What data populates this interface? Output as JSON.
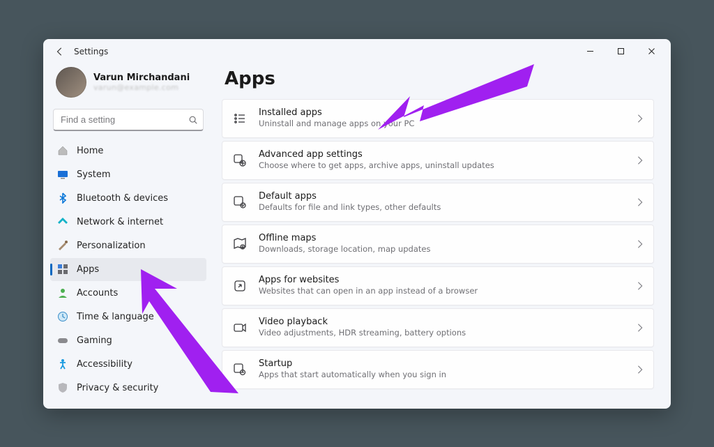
{
  "window": {
    "title": "Settings"
  },
  "profile": {
    "name": "Varun Mirchandani",
    "sub": "varun@example.com"
  },
  "search": {
    "placeholder": "Find a setting"
  },
  "sidebar": {
    "items": [
      {
        "label": "Home"
      },
      {
        "label": "System"
      },
      {
        "label": "Bluetooth & devices"
      },
      {
        "label": "Network & internet"
      },
      {
        "label": "Personalization"
      },
      {
        "label": "Apps"
      },
      {
        "label": "Accounts"
      },
      {
        "label": "Time & language"
      },
      {
        "label": "Gaming"
      },
      {
        "label": "Accessibility"
      },
      {
        "label": "Privacy & security"
      }
    ]
  },
  "page": {
    "title": "Apps"
  },
  "cards": [
    {
      "title": "Installed apps",
      "sub": "Uninstall and manage apps on your PC"
    },
    {
      "title": "Advanced app settings",
      "sub": "Choose where to get apps, archive apps, uninstall updates"
    },
    {
      "title": "Default apps",
      "sub": "Defaults for file and link types, other defaults"
    },
    {
      "title": "Offline maps",
      "sub": "Downloads, storage location, map updates"
    },
    {
      "title": "Apps for websites",
      "sub": "Websites that can open in an app instead of a browser"
    },
    {
      "title": "Video playback",
      "sub": "Video adjustments, HDR streaming, battery options"
    },
    {
      "title": "Startup",
      "sub": "Apps that start automatically when you sign in"
    }
  ]
}
